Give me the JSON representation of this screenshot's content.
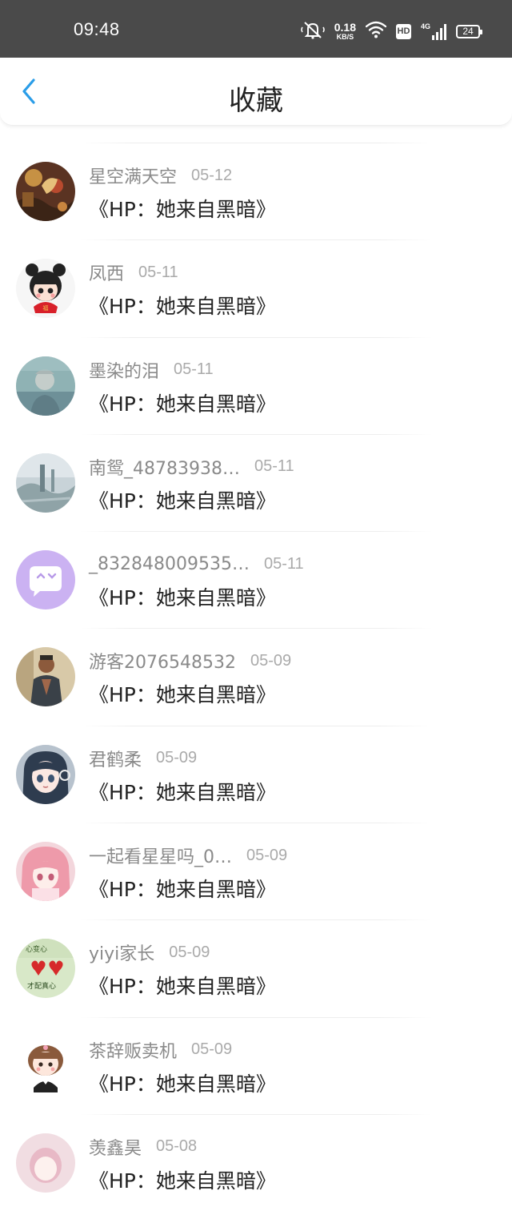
{
  "status_bar": {
    "time": "09:48",
    "speed_value": "0.18",
    "speed_unit": "KB/S",
    "hd_label": "HD",
    "network_label": "4G",
    "battery": "24",
    "icons": [
      "mute-icon",
      "wifi-icon",
      "hd-icon",
      "signal-icon",
      "battery-icon"
    ]
  },
  "header": {
    "title": "收藏",
    "back_icon": "chevron-left-icon"
  },
  "colors": {
    "accent": "#2a9de8",
    "status_bar_bg": "#4a4a4a",
    "name_text": "#8a8a8a",
    "date_text": "#aaaaaa",
    "title_text": "#222222"
  },
  "items": [
    {
      "user": "星空满天空",
      "date": "05-12",
      "title": "《HP：她来自黑暗》",
      "avatar": "artwork-avatar"
    },
    {
      "user": "凤西",
      "date": "05-11",
      "title": "《HP：她来自黑暗》",
      "avatar": "cartoon-girl-avatar"
    },
    {
      "user": "墨染的泪",
      "date": "05-11",
      "title": "《HP：她来自黑暗》",
      "avatar": "photo-avatar"
    },
    {
      "user": "南鸳_48783938…",
      "date": "05-11",
      "title": "《HP：她来自黑暗》",
      "avatar": "landscape-avatar"
    },
    {
      "user": "_832848009535…",
      "date": "05-11",
      "title": "《HP：她来自黑暗》",
      "avatar": "chat-bubble-avatar"
    },
    {
      "user": "游客2076548532",
      "date": "05-09",
      "title": "《HP：她来自黑暗》",
      "avatar": "man-photo-avatar"
    },
    {
      "user": "君鹤柔",
      "date": "05-09",
      "title": "《HP：她来自黑暗》",
      "avatar": "anime-girl-avatar"
    },
    {
      "user": "一起看星星吗_0…",
      "date": "05-09",
      "title": "《HP：她来自黑暗》",
      "avatar": "pink-hair-avatar"
    },
    {
      "user": "yiyi家长",
      "date": "05-09",
      "title": "《HP：她来自黑暗》",
      "avatar": "hearts-avatar"
    },
    {
      "user": "茶辞贩卖机",
      "date": "05-09",
      "title": "《HP：她来自黑暗》",
      "avatar": "chibi-girl-avatar"
    },
    {
      "user": "羡鑫昊",
      "date": "05-08",
      "title": "《HP：她来自黑暗》",
      "avatar": "partial-avatar"
    }
  ]
}
